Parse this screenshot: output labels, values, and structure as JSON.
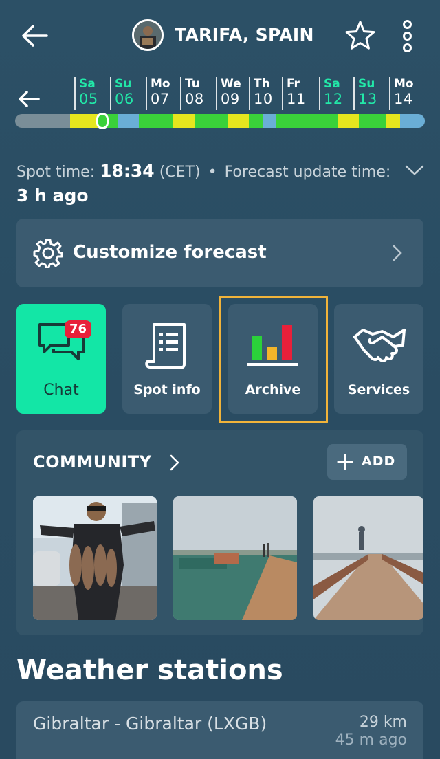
{
  "header": {
    "title": "TARIFA, SPAIN",
    "back_icon": "arrow-left-icon",
    "favorite_icon": "star-icon",
    "menu_icon": "more-vertical-icon"
  },
  "timeline": {
    "back_icon": "arrow-left-icon",
    "days": [
      {
        "name": "Sa",
        "num": "05",
        "weekend": true
      },
      {
        "name": "Su",
        "num": "06",
        "weekend": true
      },
      {
        "name": "Mo",
        "num": "07",
        "weekend": false
      },
      {
        "name": "Tu",
        "num": "08",
        "weekend": false
      },
      {
        "name": "We",
        "num": "09",
        "weekend": false
      },
      {
        "name": "Th",
        "num": "10",
        "weekend": false
      },
      {
        "name": "Fr",
        "num": "11",
        "weekend": false
      },
      {
        "name": "Sa",
        "num": "12",
        "weekend": true
      },
      {
        "name": "Su",
        "num": "13",
        "weekend": true
      },
      {
        "name": "Mo",
        "num": "14",
        "weekend": false
      }
    ],
    "colors": {
      "weekend": "#22e8a8",
      "wind_green": "#3ad13a",
      "wind_yellow": "#e6e61e",
      "wind_blue": "#6aaed6",
      "past": "#7a8e98"
    }
  },
  "spot_time": {
    "label": "Spot time:",
    "time": "18:34",
    "zone": "(CET)",
    "separator": "•",
    "update_label": "Forecast update time:",
    "update_value": "3 h ago"
  },
  "customize": {
    "label": "Customize forecast",
    "icon": "gear-icon"
  },
  "tiles": {
    "chat": {
      "label": "Chat",
      "badge": "76",
      "icon": "chat-bubbles-icon",
      "color": "#13e6a6"
    },
    "spot_info": {
      "label": "Spot info",
      "icon": "document-icon"
    },
    "archive": {
      "label": "Archive",
      "icon": "bar-chart-icon"
    },
    "services": {
      "label": "Services",
      "icon": "handshake-icon"
    }
  },
  "community": {
    "title": "COMMUNITY",
    "add_label": "ADD",
    "photos": [
      {
        "description": "Diver holding fish catch"
      },
      {
        "description": "Harbor pier with people"
      },
      {
        "description": "Wooden jetty at dusk"
      }
    ]
  },
  "weather_stations": {
    "title": "Weather stations",
    "items": [
      {
        "name": "Gibraltar - Gibraltar (LXGB)",
        "distance": "29 km",
        "ago": "45 m ago"
      }
    ]
  },
  "accent": {
    "highlight": "#f0b33a",
    "badge": "#e8203a"
  }
}
